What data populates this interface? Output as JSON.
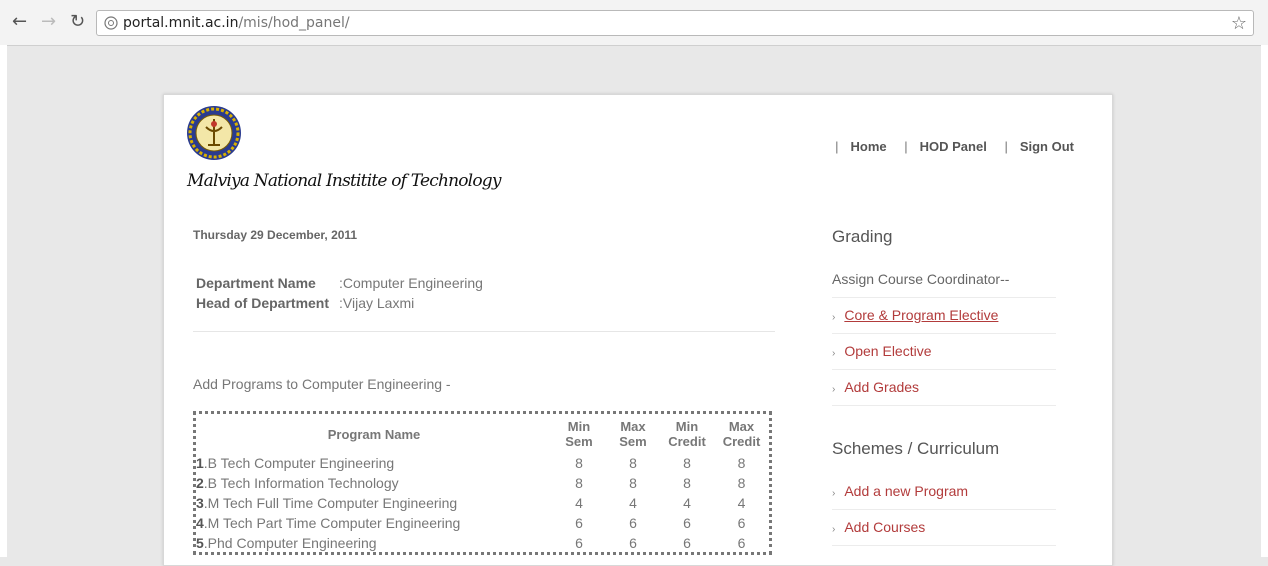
{
  "browser": {
    "url_host": "portal.mnit.ac.in",
    "url_path": "/mis/hod_panel/"
  },
  "site": {
    "brand": "Malviya National Institite of Technology"
  },
  "nav": {
    "home": "Home",
    "hod": "HOD Panel",
    "signout": "Sign Out"
  },
  "date": "Thursday 29 December, 2011",
  "department": {
    "name_label": "Department Name",
    "name_value": ":Computer Engineering",
    "head_label": "Head of Department",
    "head_value": ":Vijay Laxmi"
  },
  "add_programs_text": "Add Programs to Computer Engineering -",
  "programs": {
    "headers": {
      "name": "Program Name",
      "min_sem": [
        "Min",
        "Sem"
      ],
      "max_sem": [
        "Max",
        "Sem"
      ],
      "min_credit": [
        "Min",
        "Credit"
      ],
      "max_credit": [
        "Max",
        "Credit"
      ]
    },
    "rows": [
      {
        "idx": "1",
        "name": ".B Tech Computer Engineering",
        "min_sem": "8",
        "max_sem": "8",
        "min_credit": "8",
        "max_credit": "8"
      },
      {
        "idx": "2",
        "name": ".B Tech Information Technology",
        "min_sem": "8",
        "max_sem": "8",
        "min_credit": "8",
        "max_credit": "8"
      },
      {
        "idx": "3",
        "name": ".M Tech Full Time Computer Engineering",
        "min_sem": "4",
        "max_sem": "4",
        "min_credit": "4",
        "max_credit": "4"
      },
      {
        "idx": "4",
        "name": ".M Tech Part Time Computer Engineering",
        "min_sem": "6",
        "max_sem": "6",
        "min_credit": "6",
        "max_credit": "6"
      },
      {
        "idx": "5",
        "name": ".Phd Computer Engineering",
        "min_sem": "6",
        "max_sem": "6",
        "min_credit": "6",
        "max_credit": "6"
      }
    ]
  },
  "sidebar": {
    "grading_title": "Grading",
    "assign_text": "Assign Course Coordinator--",
    "grading_links": [
      "Core & Program Elective",
      "Open Elective",
      "Add Grades"
    ],
    "schemes_title": "Schemes / Curriculum",
    "schemes_links": [
      "Add a new Program",
      "Add Courses"
    ]
  }
}
